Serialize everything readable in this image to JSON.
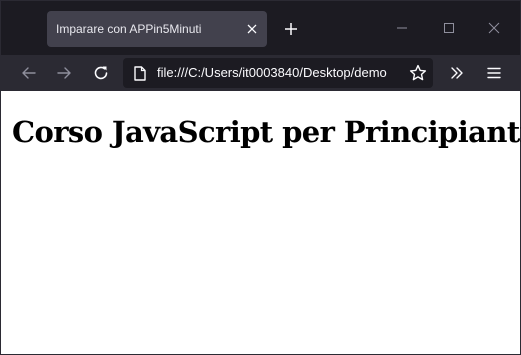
{
  "browser": {
    "tab": {
      "title": "Imparare con APPin5Minuti"
    },
    "address_bar": {
      "url": "file:///C:/Users/it0003840/Desktop/demo"
    },
    "colors": {
      "chrome_dark": "#1c1b22",
      "toolbar": "#2b2a33",
      "active_tab": "#42414d",
      "icon": "#fbfbfe",
      "icon_disabled": "#8f8f9d"
    },
    "icons": {
      "tab_close": "close-icon",
      "new_tab": "plus-icon",
      "minimize": "minimize-icon",
      "maximize": "maximize-icon",
      "close_window": "close-icon",
      "back": "arrow-left-icon",
      "forward": "arrow-right-icon",
      "reload": "reload-icon",
      "page": "page-icon",
      "bookmark": "star-icon",
      "overflow": "chevron-double-right-icon",
      "menu": "hamburger-icon"
    }
  },
  "page": {
    "heading": "Corso JavaScript per Principianti"
  }
}
